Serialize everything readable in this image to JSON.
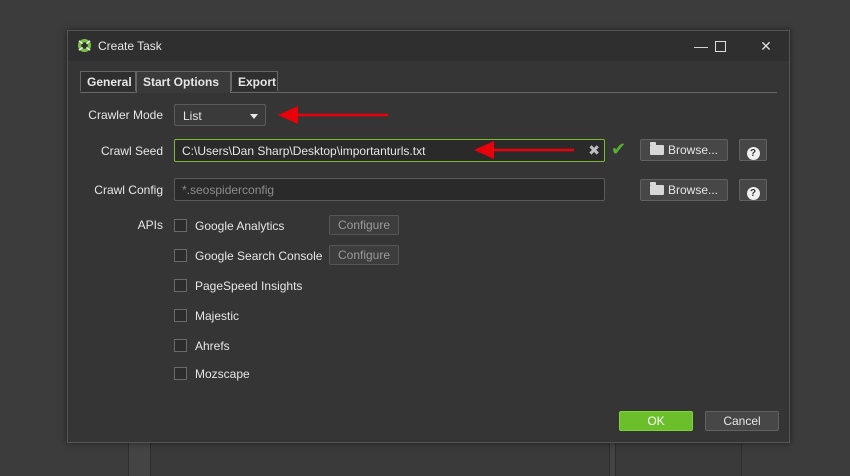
{
  "window": {
    "title": "Create Task"
  },
  "tabs": [
    {
      "label": "General"
    },
    {
      "label": "Start Options"
    },
    {
      "label": "Export"
    }
  ],
  "crawler_mode": {
    "label": "Crawler Mode",
    "value": "List"
  },
  "crawl_seed": {
    "label": "Crawl Seed",
    "value": "C:\\Users\\Dan Sharp\\Desktop\\importanturls.txt",
    "browse_label": "Browse..."
  },
  "crawl_config": {
    "label": "Crawl Config",
    "placeholder": "*.seospiderconfig",
    "browse_label": "Browse..."
  },
  "apis": {
    "label": "APIs",
    "configure_label": "Configure",
    "items": [
      {
        "label": "Google Analytics"
      },
      {
        "label": "Google Search Console"
      },
      {
        "label": "PageSpeed Insights"
      },
      {
        "label": "Majestic"
      },
      {
        "label": "Ahrefs"
      },
      {
        "label": "Mozscape"
      }
    ]
  },
  "footer": {
    "ok_label": "OK",
    "cancel_label": "Cancel"
  },
  "colors": {
    "accent_green": "#6bbf2a",
    "annotation_red": "#e8000b"
  }
}
